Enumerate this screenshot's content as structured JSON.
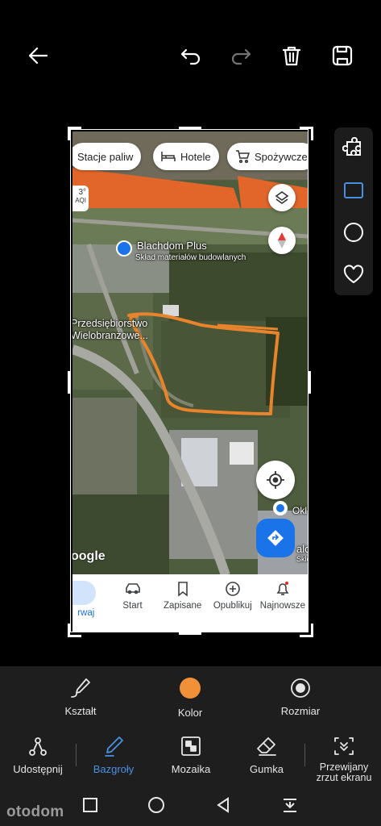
{
  "map": {
    "chips": [
      "Stacje paliw",
      "Hotele",
      "Spożywcze"
    ],
    "weather_temp": "3°",
    "weather_aqi": "AQI",
    "place1_name": "Blachdom Plus",
    "place1_desc": "Skład materiałów budowlanych",
    "place2_line1": "Przedsiębiorstwo",
    "place2_line2": "Wielobranżowe...",
    "logo": "oogle",
    "edge_label_1": "Okl",
    "edge_label_2": "alo",
    "edge_label_3": "Sklep",
    "nav": [
      "rwaj",
      "Start",
      "Zapisane",
      "Opublikuj",
      "Najnowsze"
    ]
  },
  "toolbar": {
    "row1": [
      "Kształt",
      "Kolor",
      "Rozmiar"
    ],
    "row2": [
      "Udostępnij",
      "Bazgroły",
      "Mozaika",
      "Gumka",
      "Przewijany zrzut ekranu"
    ],
    "active_color": "#f0913a",
    "active_tool_color": "#4a90e2"
  },
  "watermark": "otodom"
}
